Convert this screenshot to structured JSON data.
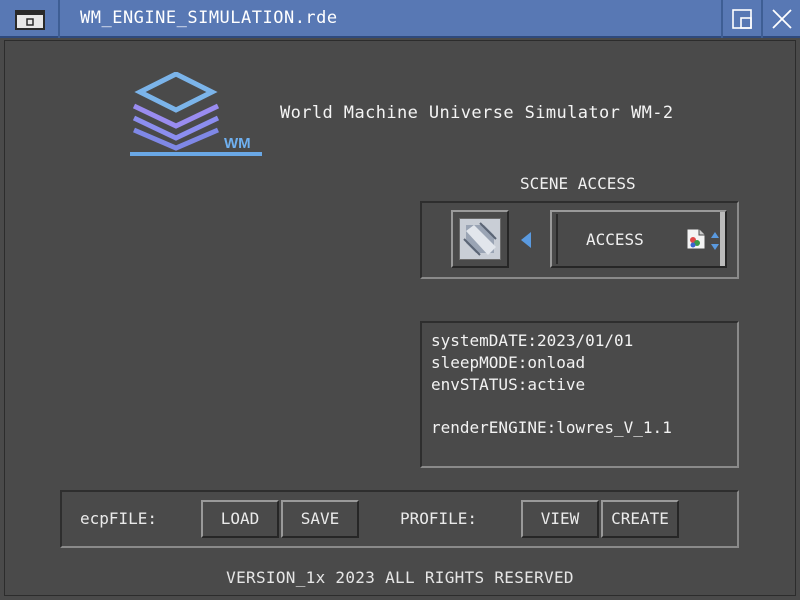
{
  "window": {
    "title": "WM_ENGINE_SIMULATION.rde"
  },
  "logo": {
    "text": "WM",
    "colors": {
      "top": "#7bb4ea",
      "middle": "#9a8cf0",
      "bottom": "#7f88e6"
    }
  },
  "header": {
    "app_title": "World Machine Universe Simulator WM-2"
  },
  "scene_access": {
    "label": "SCENE ACCESS",
    "selected_value": "ACCESS"
  },
  "status_panel": {
    "lines": [
      "systemDATE:2023/01/01",
      "sleepMODE:onload",
      "envSTATUS:active"
    ],
    "render_engine": "renderENGINE:lowres_V_1.1"
  },
  "file_bar": {
    "ecp_label": "ecpFILE:",
    "load_label": "LOAD",
    "save_label": "SAVE",
    "profile_label": "PROFILE:",
    "view_label": "VIEW",
    "create_label": "CREATE"
  },
  "footer": {
    "text": "VERSION_1x 2023 ALL RIGHTS RESERVED"
  },
  "colors": {
    "titlebar": "#5878b4",
    "background": "#4a4a4a",
    "text": "#f0f0f0",
    "accent_blue": "#5a8fd0"
  }
}
